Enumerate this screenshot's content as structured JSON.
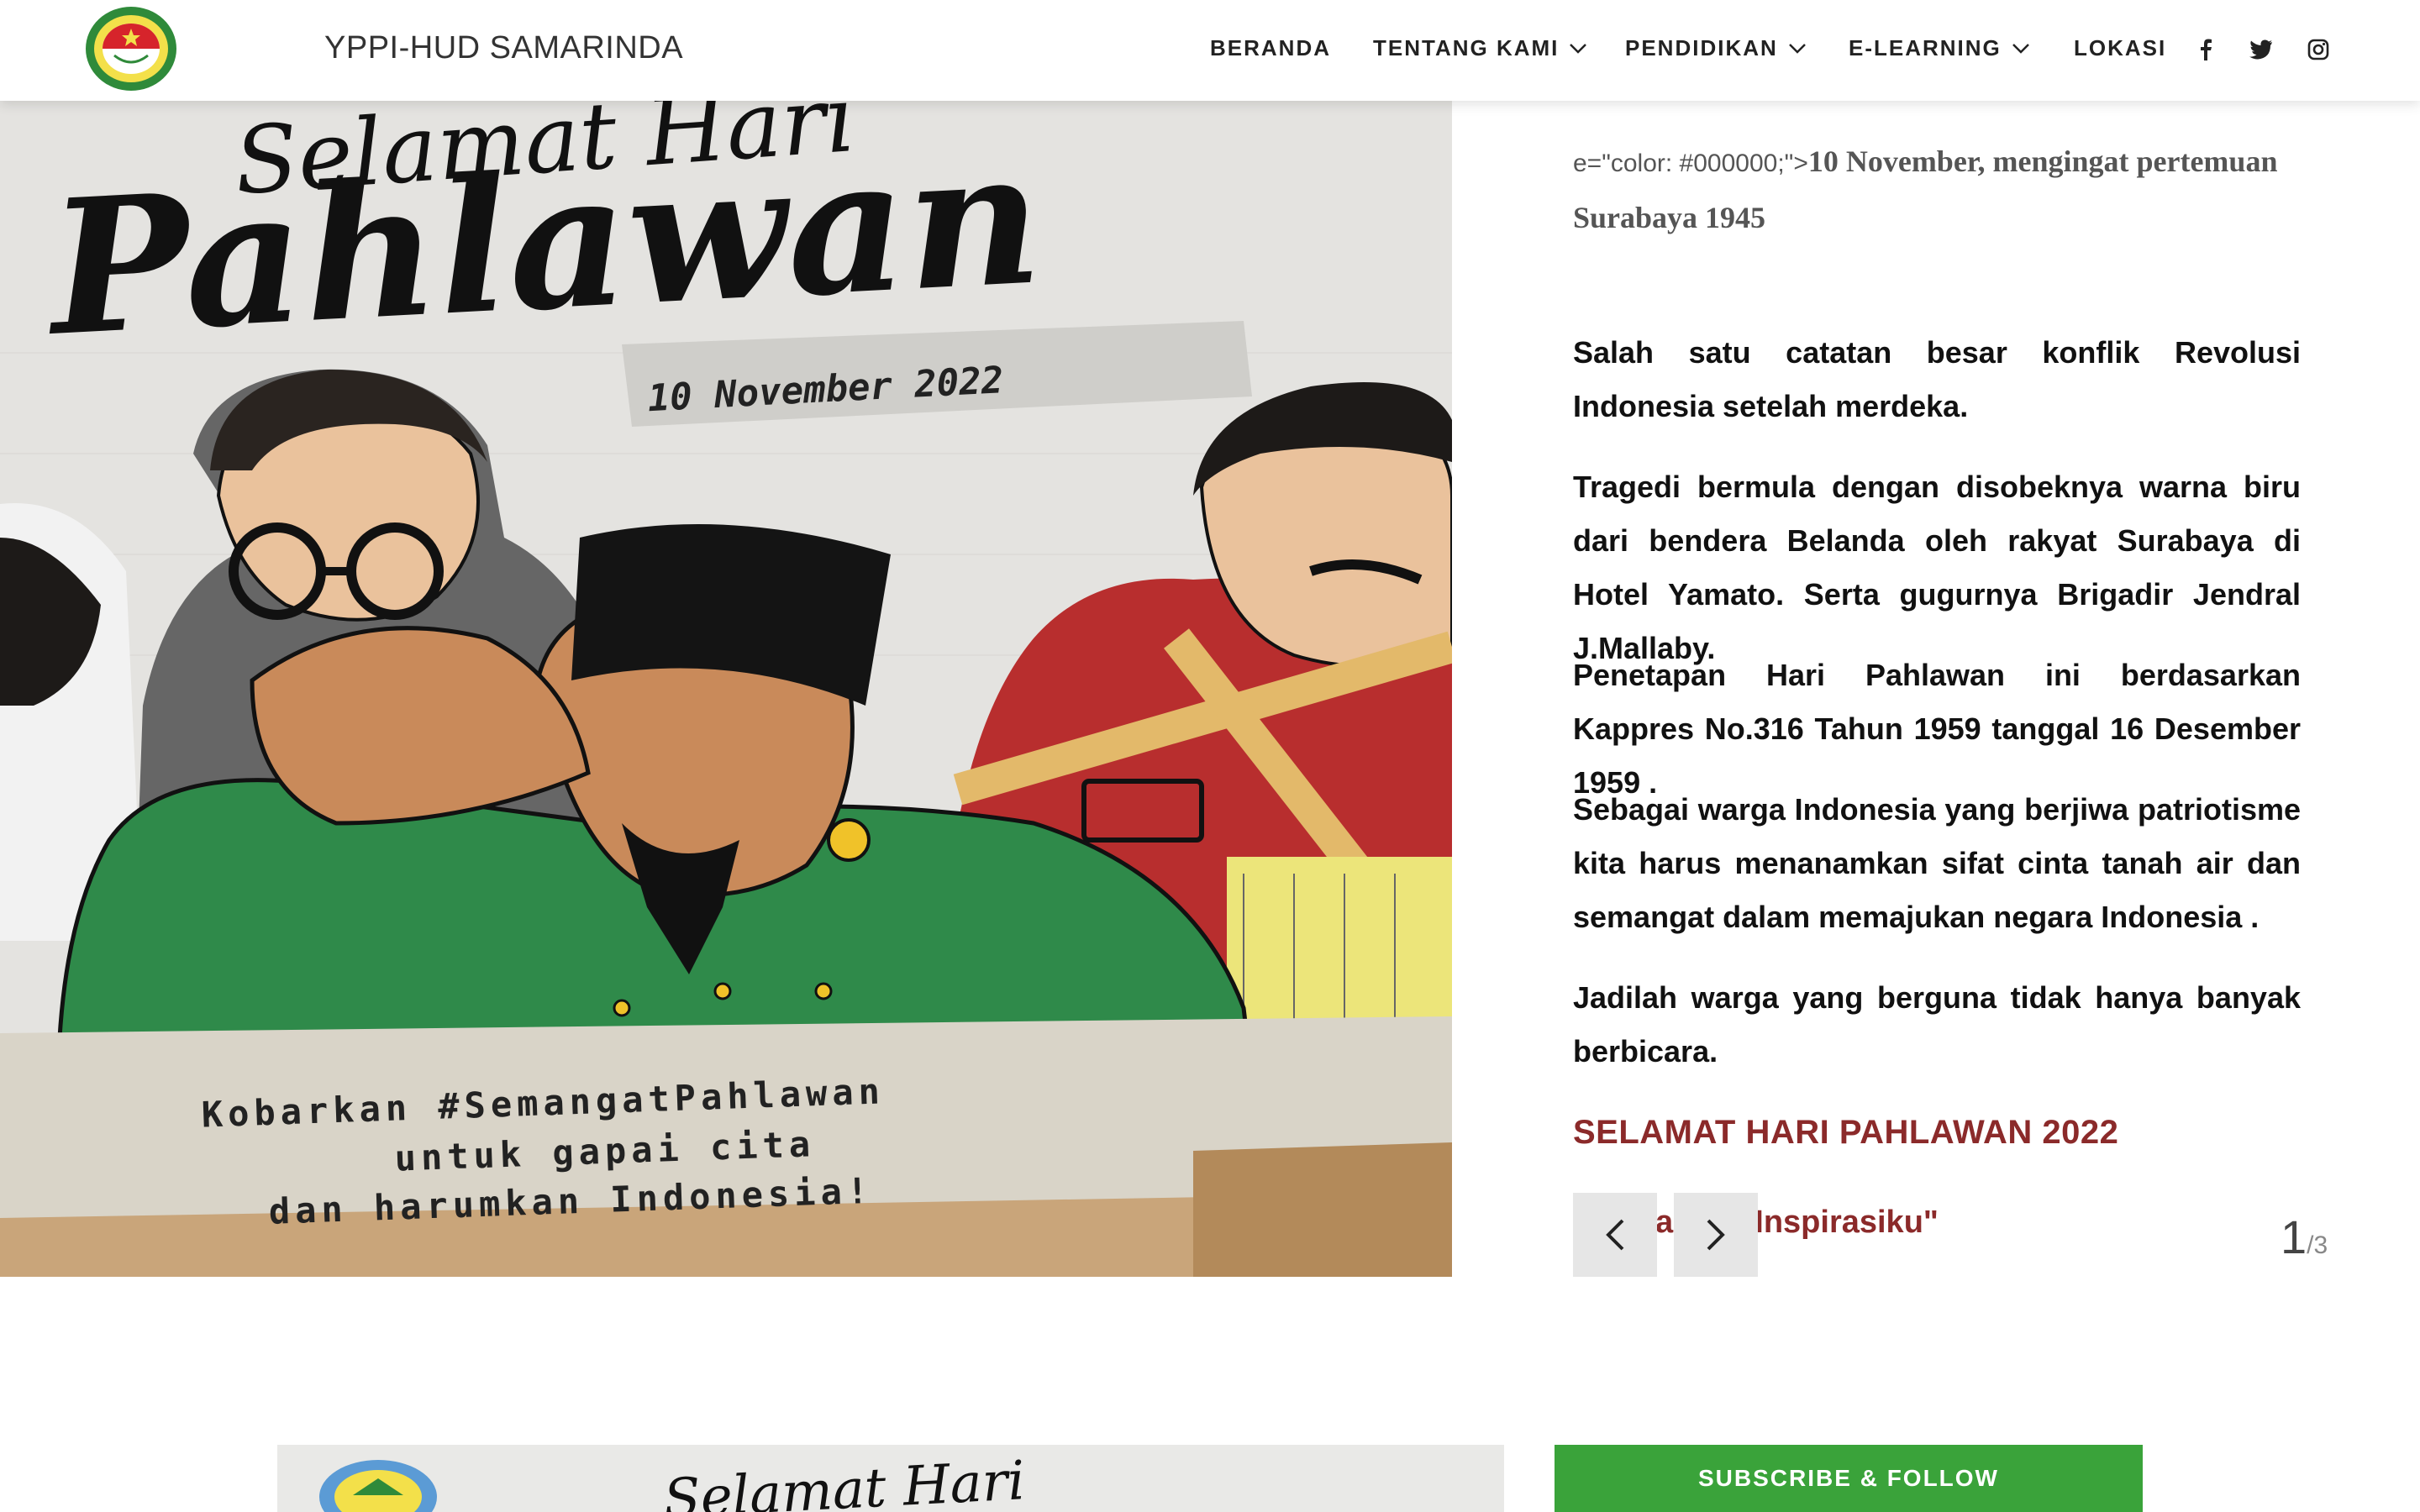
{
  "header": {
    "site_title": "YPPI-HUD SAMARINDA",
    "nav": [
      {
        "label": "BERANDA"
      },
      {
        "label": "TENTANG KAMI"
      },
      {
        "label": "PENDIDIKAN"
      },
      {
        "label": "E-LEARNING"
      },
      {
        "label": "LOKASI"
      }
    ],
    "social_icons": [
      "facebook-icon",
      "twitter-icon",
      "instagram-icon"
    ]
  },
  "poster": {
    "title_script": "Selamat Hari",
    "title_main": "Pahlawan",
    "date": "10 November 2022",
    "tagline_lines": [
      "Kobarkan #SemangatPahlawan",
      "untuk gapai cita",
      "dan harumkan Indonesia!"
    ]
  },
  "article": {
    "intro_code": "e=\"color: #000000;\">",
    "intro_text": "10 November, mengingat pertemuan Surabaya 1945",
    "paragraphs": [
      "Salah satu catatan besar konflik Revolusi Indonesia setelah merdeka.",
      "Tragedi bermula dengan disobeknya warna biru dari bendera Belanda oleh rakyat Surabaya di Hotel Yamato. Serta gugurnya Brigadir Jendral J.Mallaby.",
      "Penetapan Hari Pahlawan ini berdasarkan Kappres No.316 Tahun 1959 tanggal 16 Desember 1959 .",
      "Sebagai warga Indonesia yang berjiwa patriotisme kita harus menanamkan sifat cinta tanah air dan semangat dalam memajukan negara Indonesia .",
      "Jadilah warga yang berguna tidak hanya banyak berbicara."
    ],
    "celebrate": "SELAMAT HARI PAHLAWAN 2022",
    "inspire_fragment": "a    ku Inspirasiku\""
  },
  "slider": {
    "current": "1",
    "total": "/3"
  },
  "bottom": {
    "thumb_script": "Selamat Hari",
    "subscribe_label": "SUBSCRIBE & FOLLOW"
  },
  "colors": {
    "accent_red": "#8b2a2a",
    "subscribe_green": "#3aa33a"
  }
}
